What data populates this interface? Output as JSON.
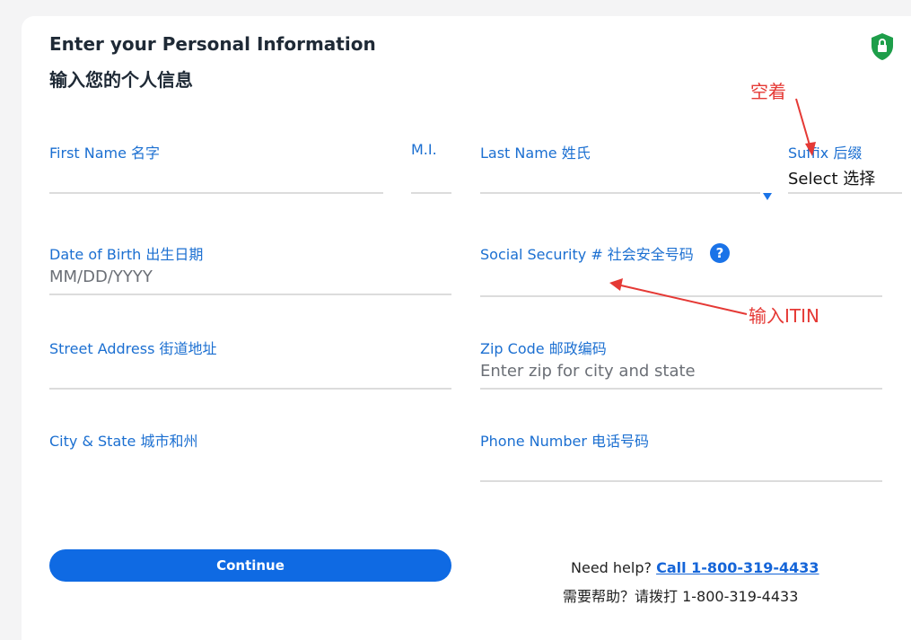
{
  "header": {
    "title_en": "Enter your Personal Information",
    "title_zh": "输入您的个人信息",
    "secure_icon": "shield-lock-icon",
    "secure_color": "#1e9e4a"
  },
  "fields": {
    "first_name": {
      "label": "First Name  名字",
      "value": ""
    },
    "mi": {
      "label": "M.I.",
      "value": ""
    },
    "last_name": {
      "label": "Last Name  姓氏",
      "value": ""
    },
    "suffix": {
      "label": "Suffix  后缀",
      "selected": "Select  选择"
    },
    "dob": {
      "label": "Date of Birth  出生日期",
      "placeholder": "MM/DD/YYYY"
    },
    "ssn": {
      "label": "Social Security #  社会安全号码",
      "help_icon": "?"
    },
    "street": {
      "label": "Street Address  街道地址",
      "value": ""
    },
    "zip": {
      "label": "Zip Code  邮政编码",
      "placeholder": "Enter zip for city and state"
    },
    "city_state": {
      "label": "City & State  城市和州",
      "value": ""
    },
    "phone": {
      "label": "Phone Number  电话号码",
      "value": ""
    }
  },
  "actions": {
    "continue_label": "Continue",
    "accent": "#0f6ae3"
  },
  "help": {
    "prefix": "Need help?",
    "link": "Call 1-800-319-4433",
    "zh": "需要帮助？请拨打 1-800-319-4433"
  },
  "annotations": {
    "suffix_note": "空着",
    "ssn_note": "输入ITIN",
    "color": "#e53935"
  }
}
